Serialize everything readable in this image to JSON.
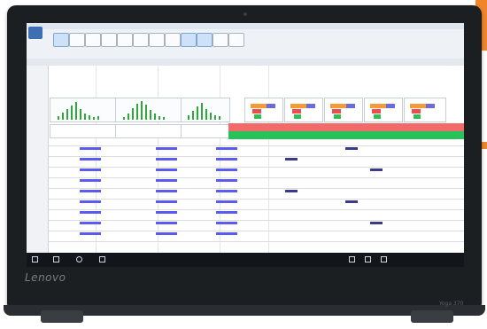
{
  "device": {
    "brand": "Lenovo",
    "model": "Yoga 370"
  },
  "colors": {
    "accent_orange": "#f0852a",
    "chart_green": "#2fa83a",
    "band_red": "#f26b6b",
    "band_green": "#27c25a",
    "value_blue": "#5a5cf0"
  },
  "icons": [
    "windows-start-icon",
    "back-icon",
    "circle-icon",
    "task-view-icon",
    "pen-icon",
    "network-icon",
    "volume-icon"
  ]
}
